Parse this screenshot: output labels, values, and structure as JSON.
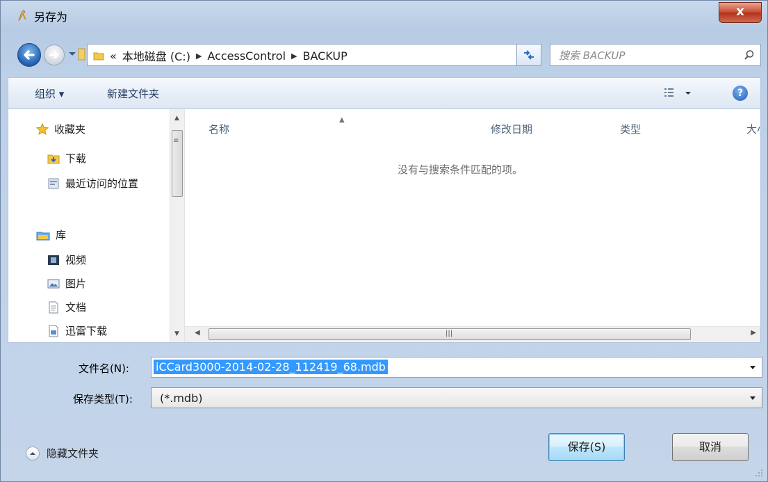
{
  "window": {
    "title": "另存为",
    "close_label": "x"
  },
  "address": {
    "prefix": "«",
    "crumbs": [
      "本地磁盘 (C:)",
      "AccessControl",
      "BACKUP"
    ]
  },
  "search": {
    "placeholder": "搜索 BACKUP"
  },
  "toolbar": {
    "organize": "组织 ▾",
    "new_folder": "新建文件夹"
  },
  "nav": {
    "favorites": "收藏夹",
    "downloads": "下载",
    "recent": "最近访问的位置",
    "libraries": "库",
    "videos": "视频",
    "pictures": "图片",
    "documents": "文档",
    "thunder": "迅雷下载"
  },
  "columns": {
    "name": "名称",
    "modified": "修改日期",
    "type": "类型",
    "size": "大小"
  },
  "empty_message": "没有与搜索条件匹配的项。",
  "form": {
    "filename_label": "文件名(N):",
    "filename_value": "iCCard3000-2014-02-28_112419_68.mdb",
    "filetype_label": "保存类型(T):",
    "filetype_value": "(*.mdb)"
  },
  "footer": {
    "hide_folders": "隐藏文件夹",
    "save": "保存(S)",
    "cancel": "取消"
  },
  "colors": {
    "selection": "#3399ff",
    "accent": "#1c5bb8"
  }
}
